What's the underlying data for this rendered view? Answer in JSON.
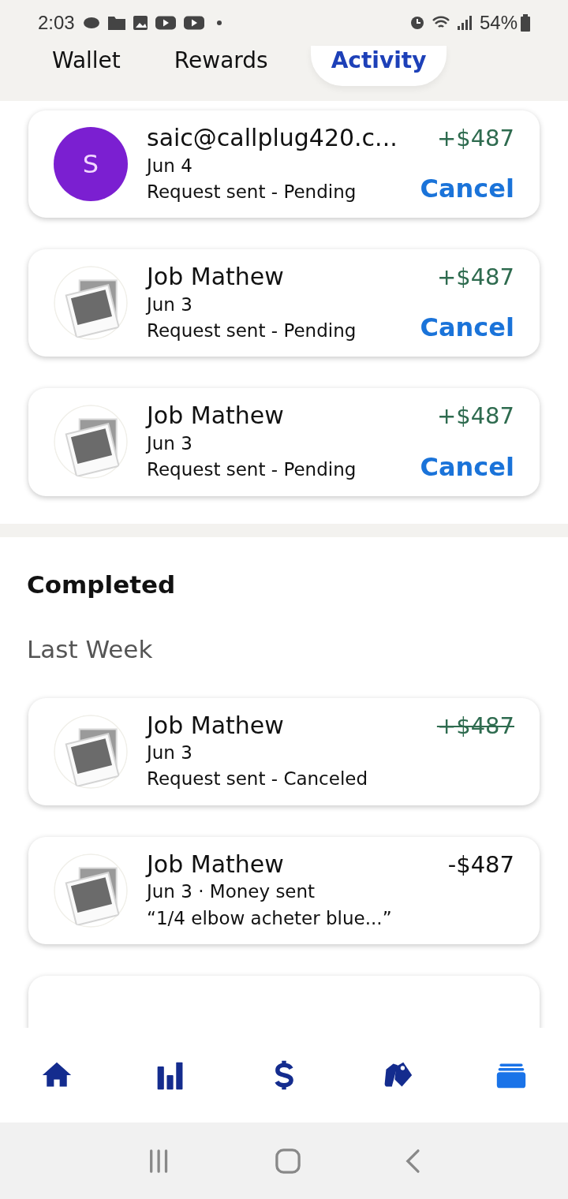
{
  "status_bar": {
    "time": "2:03",
    "battery": "54%"
  },
  "tabs": [
    {
      "label": "Wallet",
      "selected": false
    },
    {
      "label": "Rewards",
      "selected": false
    },
    {
      "label": "Activity",
      "selected": true
    }
  ],
  "pending": [
    {
      "avatar": {
        "kind": "initial",
        "letter": "S",
        "color": "#7b1fd1"
      },
      "name": "saic@callplug420.c...",
      "line_2": "Jun 4",
      "line_3": "Request sent - Pending",
      "amount": "+$487",
      "kind": "credit",
      "struck": false,
      "action": "Cancel"
    },
    {
      "avatar": {
        "kind": "placeholder"
      },
      "name": "Job Mathew",
      "line_2": "Jun 3",
      "line_3": "Request sent - Pending",
      "amount": "+$487",
      "kind": "credit",
      "struck": false,
      "action": "Cancel"
    },
    {
      "avatar": {
        "kind": "placeholder"
      },
      "name": "Job Mathew",
      "line_2": "Jun 3",
      "line_3": "Request sent - Pending",
      "amount": "+$487",
      "kind": "credit",
      "struck": false,
      "action": "Cancel"
    }
  ],
  "completed": {
    "title": "Completed",
    "group": "Last Week",
    "items": [
      {
        "avatar": {
          "kind": "placeholder"
        },
        "name": "Job Mathew",
        "line_2": "Jun 3",
        "line_3": "Request sent - Canceled",
        "amount": "+$487",
        "kind": "credit",
        "struck": true
      },
      {
        "avatar": {
          "kind": "placeholder"
        },
        "name": "Job Mathew",
        "line_2": "Jun 3 · Money sent",
        "line_3": "“1/4 elbow acheter blue...”",
        "amount": "-$487",
        "kind": "debit",
        "struck": false
      }
    ]
  },
  "bottom_nav": [
    {
      "kind": "home",
      "selected": false
    },
    {
      "kind": "chart",
      "selected": false
    },
    {
      "kind": "dollar",
      "selected": false
    },
    {
      "kind": "tags",
      "selected": false
    },
    {
      "kind": "cards",
      "selected": true
    }
  ]
}
